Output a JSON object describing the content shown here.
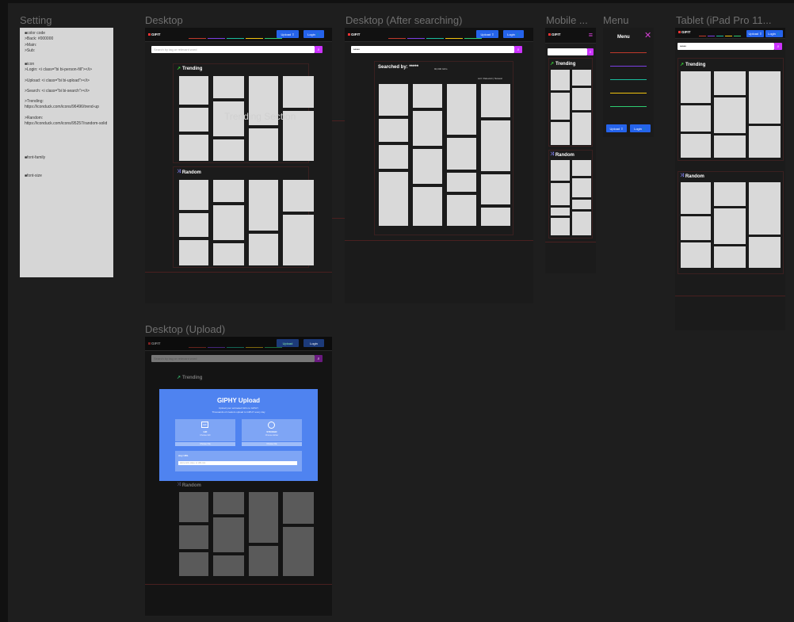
{
  "frames": {
    "setting": "Setting",
    "desktop": "Desktop",
    "desktop_search": "Desktop (After searching)",
    "mobile": "Mobile ...",
    "menu": "Menu",
    "tablet": "Tablet (iPad Pro 11...",
    "desktop_upload": "Desktop (Upload)"
  },
  "setting": {
    "color_code": "■color code",
    "back": ">Back: #000000",
    "main": ">Main:",
    "sub": ">Sub:",
    "icon": "■icon",
    "login_icon": ">Login: <i class=\"bi bi-person-fill\"></i>",
    "upload_icon": ">Upload: <i class=\"bi bi-upload\"></i>",
    "search_icon": ">Search: <i class=\"bi bi-search\"></i>",
    "trending_icon": ">Trending: https://iconduck.com/icons/96496/trend-up",
    "random_icon": ">Random: https://iconduck.com/icons/95257/random-solid",
    "font_family": "■font-family",
    "font_size": "■font-size"
  },
  "nav": {
    "logo": "GIFIT",
    "upload": "Upload",
    "login": "Login",
    "search_placeholder": "Search by tag or relevant word",
    "search_value": "*****"
  },
  "sections": {
    "trending": "Trending",
    "random": "Random",
    "trending_overlay": "Trending Section",
    "searched_by": "Searched by: *****",
    "search_count": "90,000 GIFs",
    "sort": "sort: Relevant | Newest"
  },
  "menu": {
    "title": "Menu",
    "upload": "Upload",
    "login": "Login"
  },
  "upload": {
    "title": "GIPHY Upload",
    "subtitle_1": "Upload your animated GIFs to GIPHY",
    "subtitle_2": "Thousands of creators upload to GIPHY every day",
    "gif_label": "GIF",
    "gif_sub": "Choose GIF",
    "sticker_label": "STICKER",
    "sticker_sub": "Choose sticker",
    "choose_file": "Choose File",
    "any_url": "Any URL",
    "url_hint": "Add a GIF, video, or URL link"
  },
  "colors": {
    "stripe": [
      "#c0392b",
      "#7b3fe4",
      "#1abc9c",
      "#f1c40f",
      "#2ecc71"
    ],
    "accent": "#2563eb",
    "search": "#cc33ff"
  }
}
